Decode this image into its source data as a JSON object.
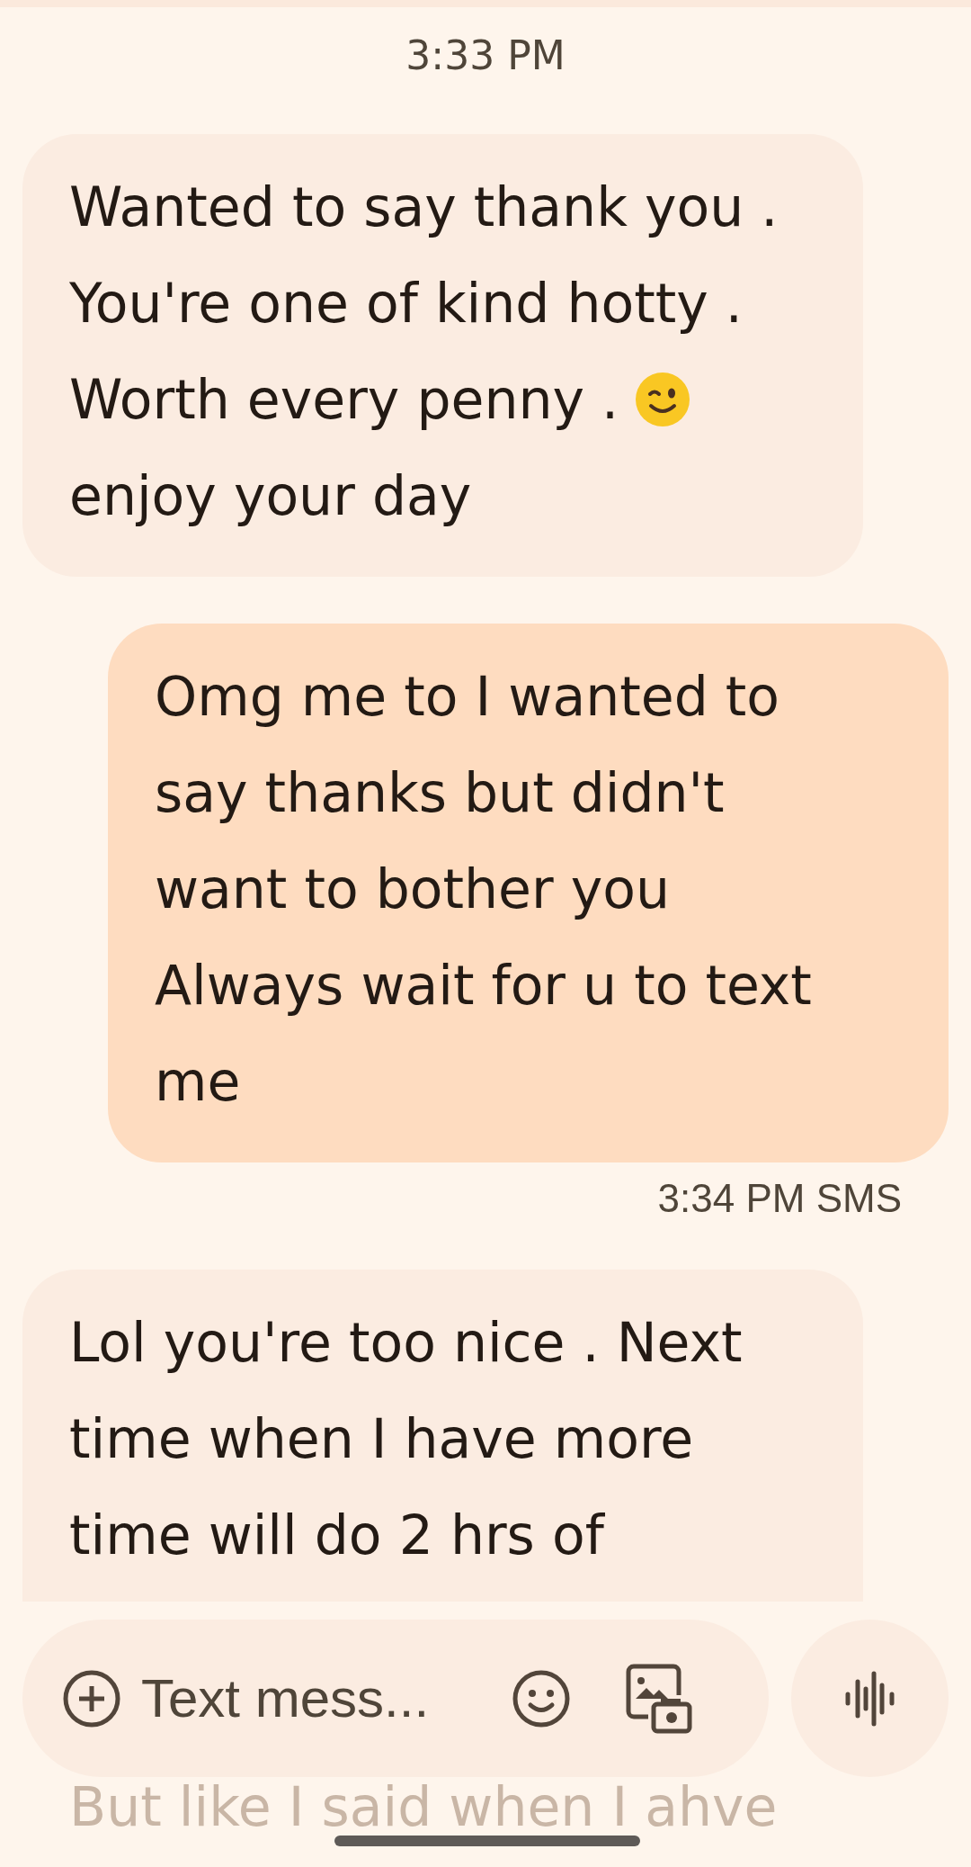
{
  "header_time": "3:33 PM",
  "messages": [
    {
      "kind": "incoming",
      "cut": false,
      "lines": [
        {
          "kind": "plain",
          "text": "Wanted to say thank you ."
        },
        {
          "kind": "plain",
          "text": "You're one of kind hotty ."
        },
        {
          "kind": "wink",
          "text": "Worth every penny ."
        },
        {
          "kind": "plain",
          "text": "enjoy your day"
        }
      ]
    },
    {
      "kind": "outgoing",
      "cut": false,
      "lines": [
        {
          "kind": "plain",
          "text": "Omg me to I wanted to"
        },
        {
          "kind": "plain",
          "text": "say thanks but didn't"
        },
        {
          "kind": "plain",
          "text": "want to bother you"
        },
        {
          "kind": "plain",
          "text": "Always wait for u to text"
        },
        {
          "kind": "plain",
          "text": "me"
        }
      ],
      "meta": "3:34 PM SMS"
    },
    {
      "kind": "incoming",
      "cut": true,
      "lines": [
        {
          "kind": "plain",
          "text": "Lol you're too nice . Next"
        },
        {
          "kind": "plain",
          "text": "time when I have more"
        },
        {
          "kind": "plain",
          "text": "time will do 2 hrs of"
        }
      ]
    }
  ],
  "faded_line": "But like I said when I ahve",
  "composer": {
    "placeholder": "Text mess..."
  }
}
